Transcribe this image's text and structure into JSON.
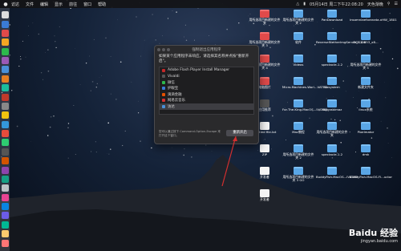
{
  "menubar": {
    "apple": "",
    "items": [
      "访达",
      "文件",
      "编辑",
      "显示",
      "前往",
      "窗口",
      "帮助"
    ],
    "status_text": "05月14日 周二下午22:08:20",
    "user": "天色渐晚"
  },
  "dialog": {
    "title": "强制退出应用程序",
    "description": "如果某个应用程序未响应，请选择其名称并点按\"重新开启\"。",
    "apps": [
      {
        "name": "Adobe Flash Player Install Manager",
        "color": "#c62828"
      },
      {
        "name": "Vivaldi",
        "color": "#555"
      },
      {
        "name": "微信",
        "color": "#2db84d"
      },
      {
        "name": "护眼宝",
        "color": "#3a7bd5"
      },
      {
        "name": "滴滴金融",
        "color": "#e65100"
      },
      {
        "name": "网易云音乐",
        "color": "#d32f2f"
      },
      {
        "name": "访达",
        "color": "#4a90d9"
      }
    ],
    "selected_index": 6,
    "footer_text": "您可以通过按下 Command-Option-Escape 来打开这个窗口。",
    "relaunch_button": "重新开启"
  },
  "desktop_icons": [
    {
      "label": "用所选项目新建的文件夹",
      "type": "folder-red"
    },
    {
      "label": "用所选项目新建的文件夹 2",
      "type": "folder"
    },
    {
      "label": "PanDownload",
      "type": "folder"
    },
    {
      "label": "insomniaeforanata.xHW_1801",
      "type": "folder"
    },
    {
      "label": "用所选项目新建的文件夹 3",
      "type": "folder-red"
    },
    {
      "label": "软件",
      "type": "folder"
    },
    {
      "label": "ReverseINetherlmgServer_1.2.0",
      "type": "folder"
    },
    {
      "label": "DGS10653_x8...",
      "type": "folder"
    },
    {
      "label": "用所选项目新建的文件夹 4",
      "type": "folder-red"
    },
    {
      "label": "Videos",
      "type": "folder"
    },
    {
      "label": "spectacle-1.2",
      "type": "folder"
    },
    {
      "label": "用所选项目新建的文件夹 5",
      "type": "folder"
    },
    {
      "label": "电脑图片",
      "type": "folder-red"
    },
    {
      "label": "Micro.Machines.Worl...VATED",
      "type": "folder"
    },
    {
      "label": "Uxsystem",
      "type": "folder"
    },
    {
      "label": "新建文件夹",
      "type": "folder"
    },
    {
      "label": "应用推荐",
      "type": "dark"
    },
    {
      "label": "For.The.King.MacOS...IVATED",
      "type": "folder"
    },
    {
      "label": "skygrabimaz",
      "type": "folder"
    },
    {
      "label": "linux系统",
      "type": "folder"
    },
    {
      "label": "untitled file.txt",
      "type": "file"
    },
    {
      "label": "Mac教程",
      "type": "folder"
    },
    {
      "label": "用所选项目新建的文件夹",
      "type": "folder"
    },
    {
      "label": "Pixelmator",
      "type": "folder"
    },
    {
      "label": "ZIP",
      "type": "file"
    },
    {
      "label": "用所选项目新建的文件夹 2",
      "type": "folder"
    },
    {
      "label": "spectacle-1.2",
      "type": "folder"
    },
    {
      "label": "dmk",
      "type": "folder"
    },
    {
      "label": "开发者",
      "type": "file"
    },
    {
      "label": "用所选项目新建的文件夹 3 GO",
      "type": "folder"
    },
    {
      "label": "BuddyFish.MacOS...IVATED",
      "type": "folder"
    },
    {
      "label": "BuddyFish.MacOS.Fl...uctor",
      "type": "folder"
    },
    {
      "label": "开发者",
      "type": "file"
    }
  ],
  "watermark": {
    "main": "Baidu 经验",
    "sub": "jingyan.baidu.com"
  },
  "colors": {
    "accent": "#4a90d9",
    "dialog_bg": "#2a2a2c",
    "arrow": "#d32f2f"
  }
}
